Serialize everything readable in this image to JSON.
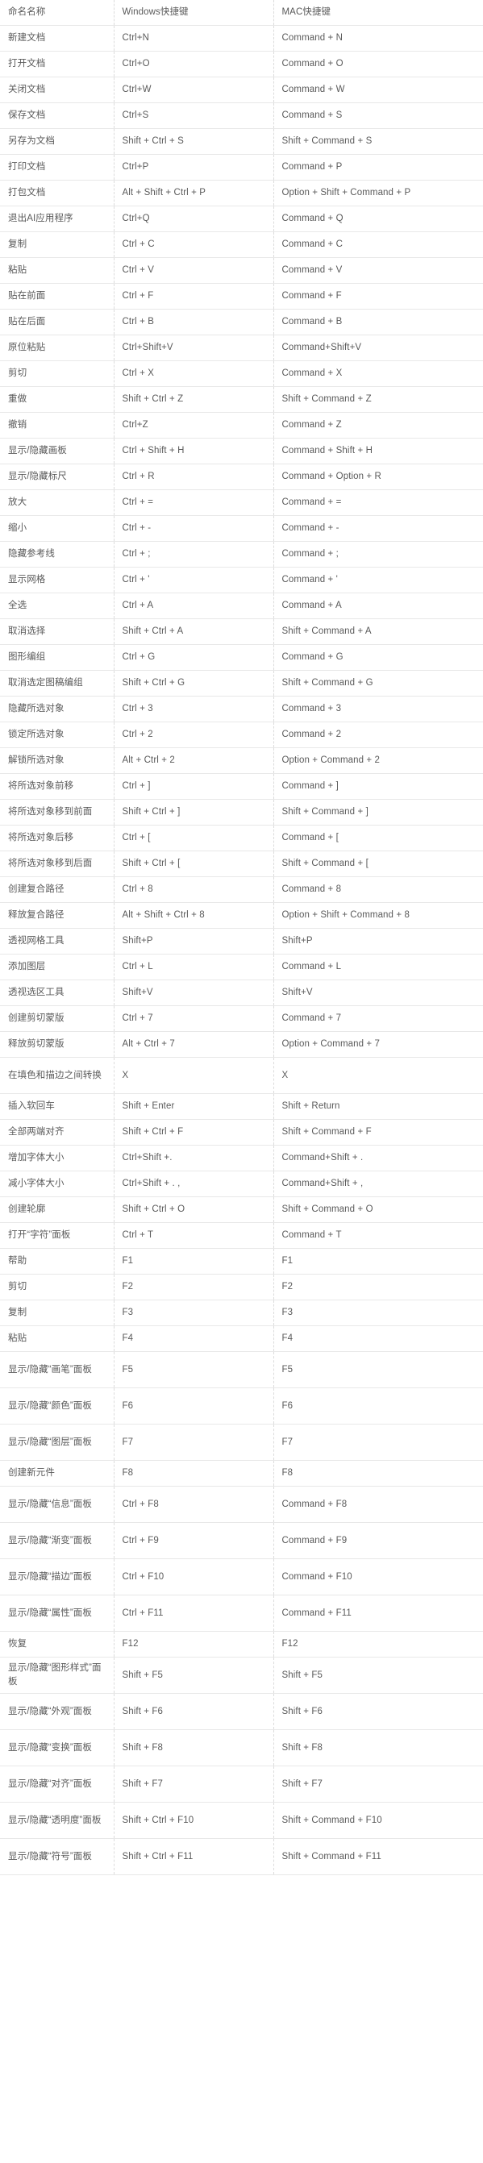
{
  "table": {
    "columns": [
      "命名名称",
      "Windows快捷键",
      "MAC快捷键"
    ],
    "rows": [
      {
        "name": "新建文档",
        "win": "Ctrl+N",
        "mac": "Command + N"
      },
      {
        "name": "打开文档",
        "win": "Ctrl+O",
        "mac": "Command + O"
      },
      {
        "name": "关闭文档",
        "win": "Ctrl+W",
        "mac": "Command + W"
      },
      {
        "name": "保存文档",
        "win": "Ctrl+S",
        "mac": "Command + S"
      },
      {
        "name": "另存为文档",
        "win": "Shift + Ctrl + S",
        "mac": "Shift + Command + S"
      },
      {
        "name": "打印文档",
        "win": "Ctrl+P",
        "mac": "Command + P"
      },
      {
        "name": "打包文档",
        "win": "Alt + Shift + Ctrl + P",
        "mac": "Option + Shift + Command + P"
      },
      {
        "name": "退出AI应用程序",
        "win": "Ctrl+Q",
        "mac": "Command + Q"
      },
      {
        "name": "复制",
        "win": "Ctrl + C",
        "mac": "Command + C"
      },
      {
        "name": "粘贴",
        "win": "Ctrl + V",
        "mac": "Command + V"
      },
      {
        "name": "贴在前面",
        "win": "Ctrl + F",
        "mac": "Command + F"
      },
      {
        "name": "贴在后面",
        "win": "Ctrl + B",
        "mac": "Command + B"
      },
      {
        "name": "原位粘贴",
        "win": "Ctrl+Shift+V",
        "mac": "Command+Shift+V"
      },
      {
        "name": "剪切",
        "win": "Ctrl + X",
        "mac": "Command + X"
      },
      {
        "name": "重做",
        "win": "Shift + Ctrl + Z",
        "mac": "Shift + Command + Z"
      },
      {
        "name": "撤销",
        "win": "Ctrl+Z",
        "mac": "Command + Z"
      },
      {
        "name": "显示/隐藏画板",
        "win": "Ctrl + Shift + H",
        "mac": "Command + Shift + H"
      },
      {
        "name": "显示/隐藏标尺",
        "win": "Ctrl + R",
        "mac": "Command + Option + R"
      },
      {
        "name": "放大",
        "win": "Ctrl + =",
        "mac": "Command + ="
      },
      {
        "name": "缩小",
        "win": "Ctrl + -",
        "mac": "Command + -"
      },
      {
        "name": "隐藏参考线",
        "win": "Ctrl + ;",
        "mac": "Command + ;"
      },
      {
        "name": "显示网格",
        "win": "Ctrl + '",
        "mac": "Command + '"
      },
      {
        "name": "全选",
        "win": "Ctrl + A",
        "mac": "Command + A"
      },
      {
        "name": "取消选择",
        "win": "Shift + Ctrl + A",
        "mac": "Shift + Command + A"
      },
      {
        "name": "图形编组",
        "win": "Ctrl + G",
        "mac": "Command + G"
      },
      {
        "name": "取消选定图稿编组",
        "win": "Shift + Ctrl + G",
        "mac": "Shift + Command + G"
      },
      {
        "name": "隐藏所选对象",
        "win": "Ctrl + 3",
        "mac": "Command + 3"
      },
      {
        "name": "锁定所选对象",
        "win": "Ctrl + 2",
        "mac": "Command + 2"
      },
      {
        "name": "解锁所选对象",
        "win": "Alt + Ctrl + 2",
        "mac": "Option + Command + 2"
      },
      {
        "name": "将所选对象前移",
        "win": "Ctrl + ]",
        "mac": "Command + ]"
      },
      {
        "name": "将所选对象移到前面",
        "win": "Shift + Ctrl + ]",
        "mac": "Shift + Command + ]"
      },
      {
        "name": "将所选对象后移",
        "win": "Ctrl + [",
        "mac": "Command + ["
      },
      {
        "name": "将所选对象移到后面",
        "win": "Shift + Ctrl + [",
        "mac": "Shift + Command + ["
      },
      {
        "name": "创建复合路径",
        "win": "Ctrl + 8",
        "mac": "Command + 8"
      },
      {
        "name": "释放复合路径",
        "win": "Alt + Shift + Ctrl + 8",
        "mac": "Option + Shift + Command + 8"
      },
      {
        "name": "透视网格工具",
        "win": "Shift+P",
        "mac": "Shift+P"
      },
      {
        "name": "添加图层",
        "win": "Ctrl + L",
        "mac": "Command + L"
      },
      {
        "name": "透视选区工具",
        "win": "Shift+V",
        "mac": "Shift+V"
      },
      {
        "name": "创建剪切蒙版",
        "win": "Ctrl + 7",
        "mac": "Command + 7"
      },
      {
        "name": "释放剪切蒙版",
        "win": "Alt + Ctrl + 7",
        "mac": "Option + Command + 7"
      },
      {
        "name": "在填色和描边之间转换",
        "win": "X",
        "mac": "X",
        "tall": true
      },
      {
        "name": "插入软回车",
        "win": "Shift + Enter",
        "mac": "Shift + Return"
      },
      {
        "name": "全部两端对齐",
        "win": "Shift + Ctrl + F",
        "mac": "Shift + Command + F"
      },
      {
        "name": "增加字体大小",
        "win": "Ctrl+Shift +.",
        "mac": "Command+Shift + ."
      },
      {
        "name": "减小字体大小",
        "win": "Ctrl+Shift + . ,",
        "mac": "Command+Shift + ,"
      },
      {
        "name": "创建轮廓",
        "win": "Shift + Ctrl + O",
        "mac": "Shift + Command + O"
      },
      {
        "name": "打开“字符”面板",
        "win": "Ctrl + T",
        "mac": "Command + T"
      },
      {
        "name": "帮助",
        "win": "F1",
        "mac": "F1"
      },
      {
        "name": "剪切",
        "win": "F2",
        "mac": "F2"
      },
      {
        "name": "复制",
        "win": "F3",
        "mac": "F3"
      },
      {
        "name": "粘贴",
        "win": "F4",
        "mac": "F4"
      },
      {
        "name": "显示/隐藏“画笔”面板",
        "win": "F5",
        "mac": "F5",
        "tall": true,
        "justify": true
      },
      {
        "name": "显示/隐藏“颜色”面板",
        "win": "F6",
        "mac": "F6",
        "tall": true,
        "justify": true
      },
      {
        "name": "显示/隐藏“图层”面板",
        "win": "F7",
        "mac": "F7",
        "tall": true,
        "justify": true
      },
      {
        "name": "创建新元件",
        "win": "F8",
        "mac": "F8"
      },
      {
        "name": "显示/隐藏“信息”面板",
        "win": "Ctrl + F8",
        "mac": "Command + F8",
        "tall": true,
        "justify": true
      },
      {
        "name": "显示/隐藏“渐变”面板",
        "win": "Ctrl + F9",
        "mac": "Command + F9",
        "tall": true,
        "justify": true
      },
      {
        "name": "显示/隐藏“描边”面板",
        "win": "Ctrl + F10",
        "mac": "Command + F10",
        "tall": true,
        "justify": true
      },
      {
        "name": "显示/隐藏“属性”面板",
        "win": "Ctrl + F11",
        "mac": "Command + F11",
        "tall": true,
        "justify": true
      },
      {
        "name": "恢复",
        "win": "F12",
        "mac": "F12"
      },
      {
        "name": "显示/隐藏“图形样式”面板",
        "win": "Shift + F5",
        "mac": "Shift + F5",
        "tall": true
      },
      {
        "name": "显示/隐藏“外观”面板",
        "win": "Shift + F6",
        "mac": "Shift + F6",
        "tall": true,
        "justify": true
      },
      {
        "name": "显示/隐藏“变换”面板",
        "win": "Shift + F8",
        "mac": "Shift + F8",
        "tall": true,
        "justify": true
      },
      {
        "name": "显示/隐藏“对齐”面板",
        "win": "Shift + F7",
        "mac": "Shift + F7",
        "tall": true,
        "justify": true
      },
      {
        "name": "显示/隐藏“透明度”面板",
        "win": "Shift + Ctrl + F10",
        "mac": "Shift + Command + F10",
        "tall": true
      },
      {
        "name": "显示/隐藏“符号”面板",
        "win": "Shift + Ctrl + F11",
        "mac": "Shift + Command + F11",
        "tall": true,
        "justify": true
      }
    ]
  }
}
